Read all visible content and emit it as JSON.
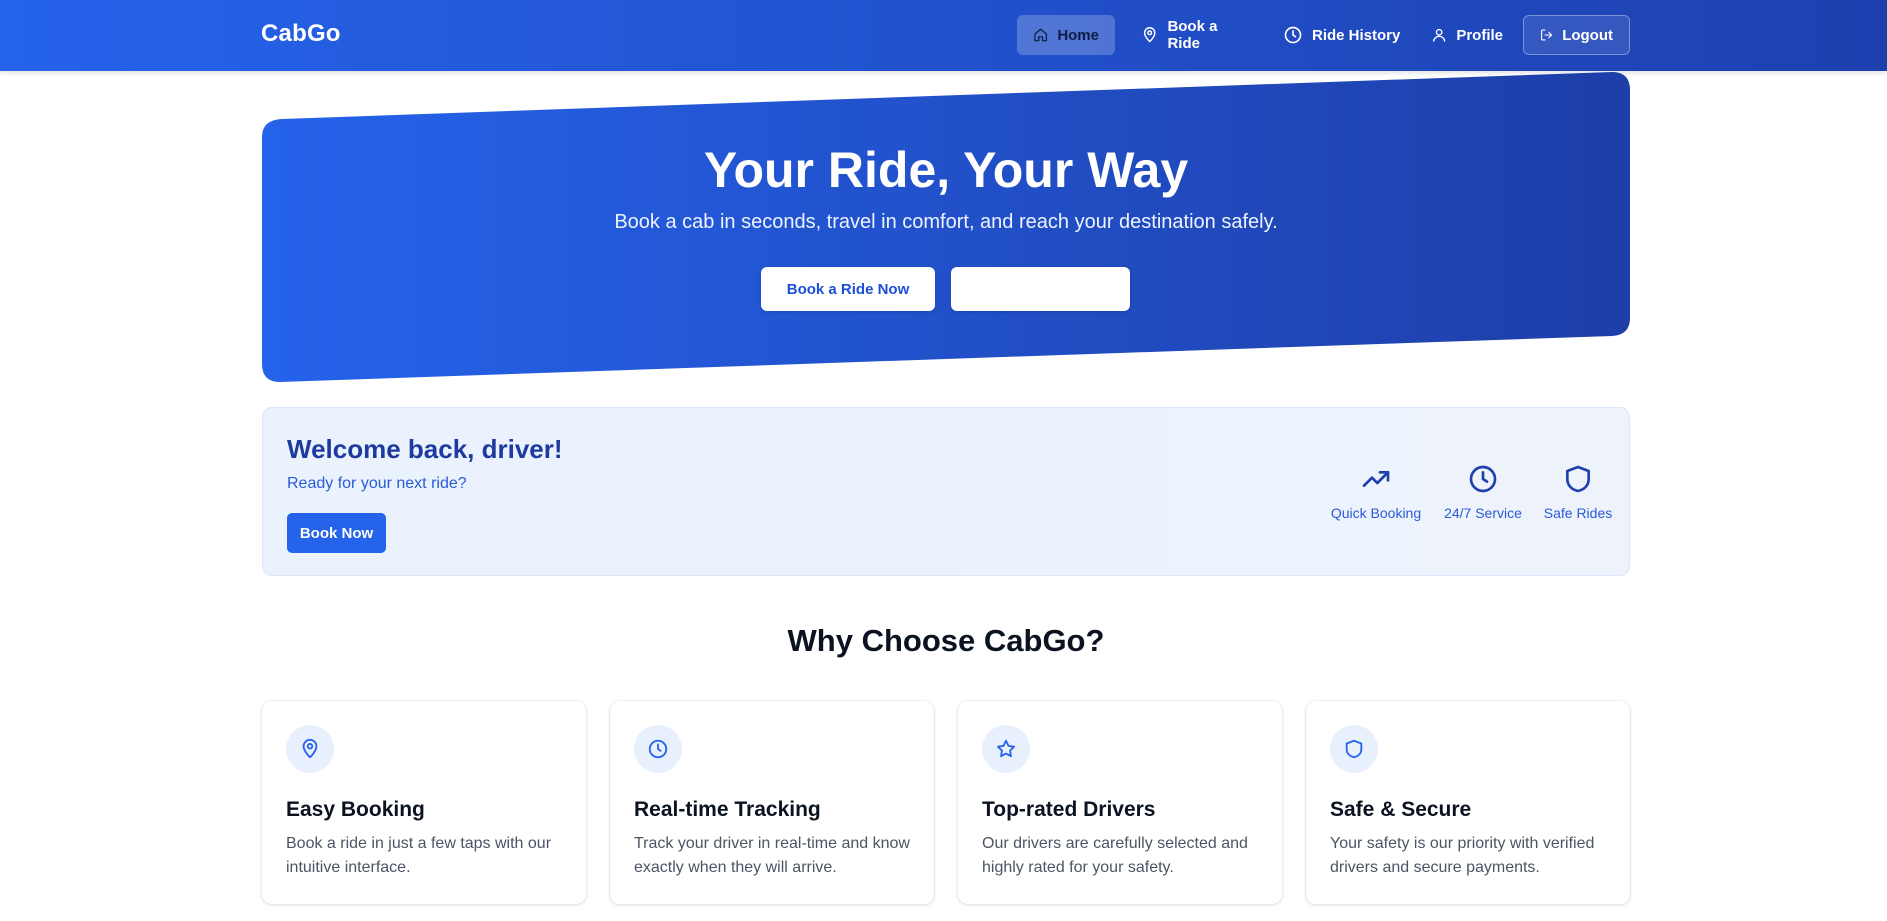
{
  "brand": {
    "name": "CabGo"
  },
  "nav": {
    "items": [
      {
        "label": "Home",
        "icon": "home-icon",
        "active": true
      },
      {
        "label": "Book a Ride",
        "icon": "map-pin-icon"
      },
      {
        "label": "Ride History",
        "icon": "clock-icon"
      },
      {
        "label": "Profile",
        "icon": "user-icon"
      },
      {
        "label": "Logout",
        "icon": "logout-icon"
      }
    ]
  },
  "hero": {
    "title": "Your Ride, Your Way",
    "subtitle": "Book a cab in seconds, travel in comfort, and reach your destination safely.",
    "primary_button": "Book a Ride Now",
    "secondary_button": ""
  },
  "welcome": {
    "title": "Welcome back, driver!",
    "subtitle": "Ready for your next ride?",
    "button": "Book Now",
    "features": [
      {
        "label": "Quick Booking",
        "icon": "trending-up-icon"
      },
      {
        "label": "24/7 Service",
        "icon": "clock-icon"
      },
      {
        "label": "Safe Rides",
        "icon": "shield-icon"
      }
    ]
  },
  "why": {
    "title": "Why Choose CabGo?",
    "cards": [
      {
        "title": "Easy Booking",
        "text": "Book a ride in just a few taps with our intuitive interface.",
        "icon": "map-pin-icon"
      },
      {
        "title": "Real-time Tracking",
        "text": "Track your driver in real-time and know exactly when they will arrive.",
        "icon": "clock-icon"
      },
      {
        "title": "Top-rated Drivers",
        "text": "Our drivers are carefully selected and highly rated for your safety.",
        "icon": "star-icon"
      },
      {
        "title": "Safe & Secure",
        "text": "Your safety is our priority with verified drivers and secure payments.",
        "icon": "shield-icon"
      }
    ]
  },
  "colors": {
    "primary": "#2563eb",
    "primary_dark": "#1e40af",
    "welcome_bg": "#eaf2fe",
    "heading_dark": "#0b1220"
  }
}
